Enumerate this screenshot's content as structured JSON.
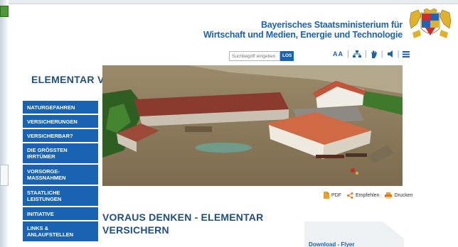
{
  "ministry": {
    "line1": "Bayerisches Staatsministerium für",
    "line2": "Wirtschaft und Medien, Energie und Technologie"
  },
  "search": {
    "placeholder": "Suchbegriff eingeben",
    "button": "LOS"
  },
  "tools": {
    "font_size": "AA"
  },
  "brand": {
    "title": "ELEMENTAR VERSICHERN"
  },
  "nav": {
    "items": [
      {
        "label": "NATURGEFAHREN"
      },
      {
        "label": "VERSICHERUNGEN"
      },
      {
        "label": "VERSICHERBAR?"
      },
      {
        "label": "DIE GRÖSSTEN IRRTÜMER"
      },
      {
        "label": "VORSORGE-MAßNAHMEN"
      },
      {
        "label": "STAATLICHE LEISTUNGEN"
      },
      {
        "label": "INITIATIVE"
      },
      {
        "label": "LINKS & ANLAUFSTELLEN"
      }
    ]
  },
  "actions": {
    "pdf": "PDF",
    "share": "Empfehlen",
    "print": "Drucken"
  },
  "article": {
    "headline": "VORAUS DENKEN - ELEMENTAR VERSICHERN"
  },
  "download": {
    "title": "Download - Flyer"
  },
  "colors": {
    "accent": "#1a63b3",
    "brand_text": "#1f4f82"
  }
}
